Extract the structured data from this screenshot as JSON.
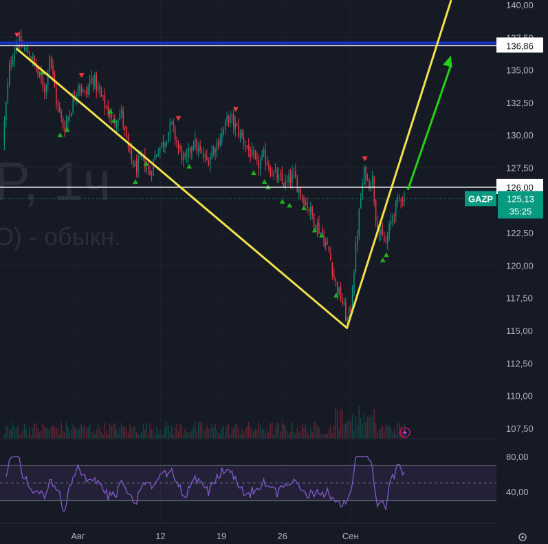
{
  "watermark": {
    "line1": "P, 1ч",
    "line2": "O) - обыкн."
  },
  "chart_data": {
    "type": "candlestick",
    "symbol": "GAZP",
    "interval": "1ч",
    "y_axis": {
      "ticks": [
        "140,00",
        "137,50",
        "135,00",
        "132,50",
        "130,00",
        "127,50",
        "125,00",
        "122,50",
        "120,00",
        "117,50",
        "115,00",
        "112,50",
        "110,00",
        "107,50"
      ],
      "ylim": [
        106.9,
        140.3
      ]
    },
    "x_axis": {
      "ticks": [
        "Авг",
        "12",
        "19",
        "26",
        "Сен"
      ]
    },
    "price_lines": [
      {
        "label": "136,86",
        "value": 136.86,
        "color": "#ffffff"
      },
      {
        "label": "126,00",
        "value": 126.0,
        "color": "#ffffff"
      }
    ],
    "current_price": {
      "symbol": "GAZP",
      "label": "125,13",
      "value": 125.13,
      "countdown": "35:25",
      "color": "#089981"
    },
    "price_path": [
      {
        "t": 0,
        "p": 129.5
      },
      {
        "t": 2,
        "p": 135.5
      },
      {
        "t": 4,
        "p": 137.2
      },
      {
        "t": 6,
        "p": 136.6
      },
      {
        "t": 8,
        "p": 136.0
      },
      {
        "t": 10,
        "p": 134.6
      },
      {
        "t": 12,
        "p": 133.4
      },
      {
        "t": 13,
        "p": 136.4
      },
      {
        "t": 15,
        "p": 132.5
      },
      {
        "t": 17,
        "p": 130.5
      },
      {
        "t": 19,
        "p": 132.0
      },
      {
        "t": 21,
        "p": 134.0
      },
      {
        "t": 23,
        "p": 133.0
      },
      {
        "t": 25,
        "p": 134.5
      },
      {
        "t": 27,
        "p": 133.2
      },
      {
        "t": 29,
        "p": 132.0
      },
      {
        "t": 31,
        "p": 131.0
      },
      {
        "t": 33,
        "p": 131.8
      },
      {
        "t": 35,
        "p": 128.8
      },
      {
        "t": 37,
        "p": 127.4
      },
      {
        "t": 39,
        "p": 128.2
      },
      {
        "t": 41,
        "p": 127.0
      },
      {
        "t": 43,
        "p": 128.8
      },
      {
        "t": 45,
        "p": 129.5
      },
      {
        "t": 47,
        "p": 130.8
      },
      {
        "t": 49,
        "p": 129.0
      },
      {
        "t": 51,
        "p": 127.8
      },
      {
        "t": 53,
        "p": 129.6
      },
      {
        "t": 55,
        "p": 128.6
      },
      {
        "t": 57,
        "p": 128.0
      },
      {
        "t": 59,
        "p": 129.0
      },
      {
        "t": 61,
        "p": 130.0
      },
      {
        "t": 63,
        "p": 131.4
      },
      {
        "t": 65,
        "p": 130.6
      },
      {
        "t": 67,
        "p": 129.7
      },
      {
        "t": 69,
        "p": 128.6
      },
      {
        "t": 71,
        "p": 127.6
      },
      {
        "t": 73,
        "p": 128.4
      },
      {
        "t": 75,
        "p": 127.2
      },
      {
        "t": 77,
        "p": 126.6
      },
      {
        "t": 79,
        "p": 126.2
      },
      {
        "t": 81,
        "p": 126.9
      },
      {
        "t": 83,
        "p": 125.6
      },
      {
        "t": 85,
        "p": 124.6
      },
      {
        "t": 87,
        "p": 123.4
      },
      {
        "t": 89,
        "p": 122.4
      },
      {
        "t": 91,
        "p": 121.0
      },
      {
        "t": 93,
        "p": 118.4
      },
      {
        "t": 95,
        "p": 117.0
      },
      {
        "t": 96,
        "p": 115.6
      },
      {
        "t": 97,
        "p": 116.6
      },
      {
        "t": 98,
        "p": 119.8
      },
      {
        "t": 99,
        "p": 122.8
      },
      {
        "t": 100,
        "p": 125.6
      },
      {
        "t": 101,
        "p": 127.4
      },
      {
        "t": 102,
        "p": 126.2
      },
      {
        "t": 103,
        "p": 127.0
      },
      {
        "t": 104,
        "p": 124.0
      },
      {
        "t": 105,
        "p": 122.4
      },
      {
        "t": 106,
        "p": 122.0
      },
      {
        "t": 107,
        "p": 121.6
      },
      {
        "t": 108,
        "p": 123.0
      },
      {
        "t": 109,
        "p": 124.2
      },
      {
        "t": 110,
        "p": 124.6
      },
      {
        "t": 111,
        "p": 125.4
      },
      {
        "t": 112,
        "p": 125.13
      }
    ],
    "trend_lines": [
      {
        "color": "#f2e14c",
        "from": {
          "t": 4,
          "p": 136.6
        },
        "to": {
          "t": 96,
          "p": 115.2
        }
      },
      {
        "color": "#f2e14c",
        "from": {
          "t": 96,
          "p": 115.2
        },
        "to": {
          "t": 125,
          "p": 140.3
        }
      }
    ],
    "arrow": {
      "color": "#26d016",
      "from": {
        "t": 113,
        "p": 125.8
      },
      "to": {
        "t": 125,
        "p": 136.1
      }
    },
    "signals": {
      "sell": [
        {
          "t": 4,
          "p": 137.7
        },
        {
          "t": 22,
          "p": 134.6
        },
        {
          "t": 49,
          "p": 131.3
        },
        {
          "t": 65,
          "p": 132.0
        },
        {
          "t": 101,
          "p": 128.2
        }
      ],
      "buy": [
        {
          "t": 11,
          "p": 134.8
        },
        {
          "t": 16,
          "p": 130.0
        },
        {
          "t": 18,
          "p": 130.4
        },
        {
          "t": 30,
          "p": 131.8
        },
        {
          "t": 31,
          "p": 131.1
        },
        {
          "t": 37,
          "p": 126.4
        },
        {
          "t": 40,
          "p": 127.8
        },
        {
          "t": 52,
          "p": 127.6
        },
        {
          "t": 70,
          "p": 127.1
        },
        {
          "t": 73,
          "p": 126.4
        },
        {
          "t": 74,
          "p": 126.0
        },
        {
          "t": 78,
          "p": 124.9
        },
        {
          "t": 80,
          "p": 124.6
        },
        {
          "t": 84,
          "p": 124.4
        },
        {
          "t": 87,
          "p": 122.7
        },
        {
          "t": 89,
          "p": 122.3
        },
        {
          "t": 93,
          "p": 117.7
        },
        {
          "t": 107,
          "p": 120.8
        },
        {
          "t": 106,
          "p": 120.4
        }
      ]
    },
    "rsi": {
      "ticks": [
        "80,00",
        "40,00"
      ],
      "upper": 70,
      "lower": 30,
      "mid": 50,
      "color": "#7e57c2"
    },
    "colors": {
      "up": "#089981",
      "down": "#f23645",
      "background": "#161a25"
    }
  }
}
